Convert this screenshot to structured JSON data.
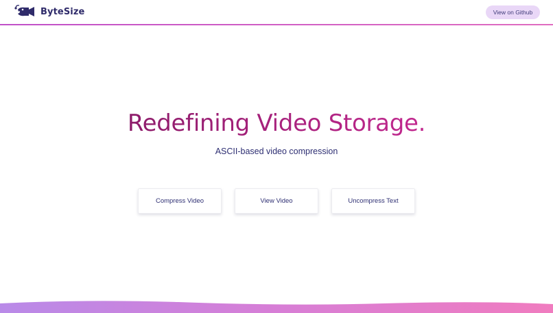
{
  "header": {
    "brand": "ByteSize",
    "logo_icon": "anglerfish-camera-icon",
    "github_label": "View on Github"
  },
  "hero": {
    "title": "Redefining Video Storage.",
    "subtitle": "ASCII-based video compression"
  },
  "actions": {
    "compress_label": "Compress Video",
    "view_label": "View Video",
    "uncompress_label": "Uncompress Text"
  },
  "colors": {
    "brand_dark": "#2f2b6a",
    "title_start": "#8d1c6a",
    "title_end": "#c2288f",
    "accent_pill": "#e9d7f7",
    "wave_start": "#b98ae8",
    "wave_end": "#f07cbf"
  }
}
